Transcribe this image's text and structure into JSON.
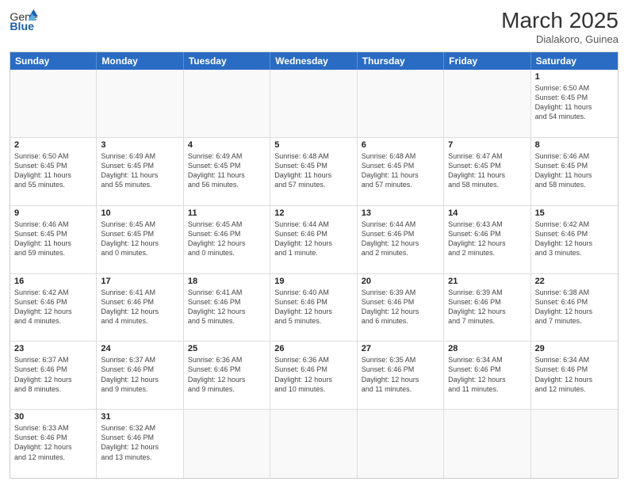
{
  "header": {
    "logo_general": "General",
    "logo_blue": "Blue",
    "month_year": "March 2025",
    "location": "Dialakoro, Guinea"
  },
  "days": [
    "Sunday",
    "Monday",
    "Tuesday",
    "Wednesday",
    "Thursday",
    "Friday",
    "Saturday"
  ],
  "weeks": [
    [
      {
        "num": "",
        "info": "",
        "empty": true
      },
      {
        "num": "",
        "info": "",
        "empty": true
      },
      {
        "num": "",
        "info": "",
        "empty": true
      },
      {
        "num": "",
        "info": "",
        "empty": true
      },
      {
        "num": "",
        "info": "",
        "empty": true
      },
      {
        "num": "",
        "info": "",
        "empty": true
      },
      {
        "num": "1",
        "info": "Sunrise: 6:50 AM\nSunset: 6:45 PM\nDaylight: 11 hours\nand 54 minutes.",
        "empty": false
      }
    ],
    [
      {
        "num": "2",
        "info": "Sunrise: 6:50 AM\nSunset: 6:45 PM\nDaylight: 11 hours\nand 55 minutes.",
        "empty": false
      },
      {
        "num": "3",
        "info": "Sunrise: 6:49 AM\nSunset: 6:45 PM\nDaylight: 11 hours\nand 55 minutes.",
        "empty": false
      },
      {
        "num": "4",
        "info": "Sunrise: 6:49 AM\nSunset: 6:45 PM\nDaylight: 11 hours\nand 56 minutes.",
        "empty": false
      },
      {
        "num": "5",
        "info": "Sunrise: 6:48 AM\nSunset: 6:45 PM\nDaylight: 11 hours\nand 57 minutes.",
        "empty": false
      },
      {
        "num": "6",
        "info": "Sunrise: 6:48 AM\nSunset: 6:45 PM\nDaylight: 11 hours\nand 57 minutes.",
        "empty": false
      },
      {
        "num": "7",
        "info": "Sunrise: 6:47 AM\nSunset: 6:45 PM\nDaylight: 11 hours\nand 58 minutes.",
        "empty": false
      },
      {
        "num": "8",
        "info": "Sunrise: 6:46 AM\nSunset: 6:45 PM\nDaylight: 11 hours\nand 58 minutes.",
        "empty": false
      }
    ],
    [
      {
        "num": "9",
        "info": "Sunrise: 6:46 AM\nSunset: 6:45 PM\nDaylight: 11 hours\nand 59 minutes.",
        "empty": false
      },
      {
        "num": "10",
        "info": "Sunrise: 6:45 AM\nSunset: 6:45 PM\nDaylight: 12 hours\nand 0 minutes.",
        "empty": false
      },
      {
        "num": "11",
        "info": "Sunrise: 6:45 AM\nSunset: 6:46 PM\nDaylight: 12 hours\nand 0 minutes.",
        "empty": false
      },
      {
        "num": "12",
        "info": "Sunrise: 6:44 AM\nSunset: 6:46 PM\nDaylight: 12 hours\nand 1 minute.",
        "empty": false
      },
      {
        "num": "13",
        "info": "Sunrise: 6:44 AM\nSunset: 6:46 PM\nDaylight: 12 hours\nand 2 minutes.",
        "empty": false
      },
      {
        "num": "14",
        "info": "Sunrise: 6:43 AM\nSunset: 6:46 PM\nDaylight: 12 hours\nand 2 minutes.",
        "empty": false
      },
      {
        "num": "15",
        "info": "Sunrise: 6:42 AM\nSunset: 6:46 PM\nDaylight: 12 hours\nand 3 minutes.",
        "empty": false
      }
    ],
    [
      {
        "num": "16",
        "info": "Sunrise: 6:42 AM\nSunset: 6:46 PM\nDaylight: 12 hours\nand 4 minutes.",
        "empty": false
      },
      {
        "num": "17",
        "info": "Sunrise: 6:41 AM\nSunset: 6:46 PM\nDaylight: 12 hours\nand 4 minutes.",
        "empty": false
      },
      {
        "num": "18",
        "info": "Sunrise: 6:41 AM\nSunset: 6:46 PM\nDaylight: 12 hours\nand 5 minutes.",
        "empty": false
      },
      {
        "num": "19",
        "info": "Sunrise: 6:40 AM\nSunset: 6:46 PM\nDaylight: 12 hours\nand 5 minutes.",
        "empty": false
      },
      {
        "num": "20",
        "info": "Sunrise: 6:39 AM\nSunset: 6:46 PM\nDaylight: 12 hours\nand 6 minutes.",
        "empty": false
      },
      {
        "num": "21",
        "info": "Sunrise: 6:39 AM\nSunset: 6:46 PM\nDaylight: 12 hours\nand 7 minutes.",
        "empty": false
      },
      {
        "num": "22",
        "info": "Sunrise: 6:38 AM\nSunset: 6:46 PM\nDaylight: 12 hours\nand 7 minutes.",
        "empty": false
      }
    ],
    [
      {
        "num": "23",
        "info": "Sunrise: 6:37 AM\nSunset: 6:46 PM\nDaylight: 12 hours\nand 8 minutes.",
        "empty": false
      },
      {
        "num": "24",
        "info": "Sunrise: 6:37 AM\nSunset: 6:46 PM\nDaylight: 12 hours\nand 9 minutes.",
        "empty": false
      },
      {
        "num": "25",
        "info": "Sunrise: 6:36 AM\nSunset: 6:46 PM\nDaylight: 12 hours\nand 9 minutes.",
        "empty": false
      },
      {
        "num": "26",
        "info": "Sunrise: 6:36 AM\nSunset: 6:46 PM\nDaylight: 12 hours\nand 10 minutes.",
        "empty": false
      },
      {
        "num": "27",
        "info": "Sunrise: 6:35 AM\nSunset: 6:46 PM\nDaylight: 12 hours\nand 11 minutes.",
        "empty": false
      },
      {
        "num": "28",
        "info": "Sunrise: 6:34 AM\nSunset: 6:46 PM\nDaylight: 12 hours\nand 11 minutes.",
        "empty": false
      },
      {
        "num": "29",
        "info": "Sunrise: 6:34 AM\nSunset: 6:46 PM\nDaylight: 12 hours\nand 12 minutes.",
        "empty": false
      }
    ],
    [
      {
        "num": "30",
        "info": "Sunrise: 6:33 AM\nSunset: 6:46 PM\nDaylight: 12 hours\nand 12 minutes.",
        "empty": false
      },
      {
        "num": "31",
        "info": "Sunrise: 6:32 AM\nSunset: 6:46 PM\nDaylight: 12 hours\nand 13 minutes.",
        "empty": false
      },
      {
        "num": "",
        "info": "",
        "empty": true
      },
      {
        "num": "",
        "info": "",
        "empty": true
      },
      {
        "num": "",
        "info": "",
        "empty": true
      },
      {
        "num": "",
        "info": "",
        "empty": true
      },
      {
        "num": "",
        "info": "",
        "empty": true
      }
    ]
  ]
}
